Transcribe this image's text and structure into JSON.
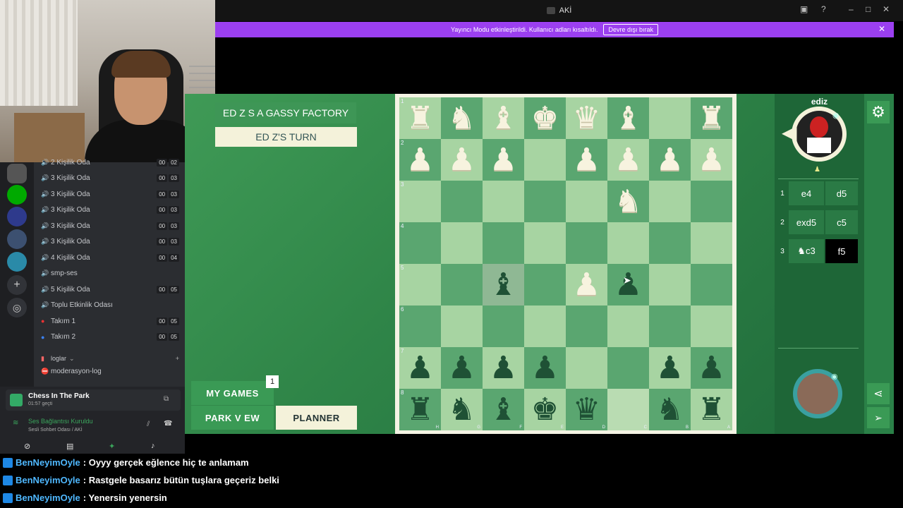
{
  "window": {
    "title": "AKİ"
  },
  "banner": {
    "message": "Yayıncı Modu etkinleştirildi. Kullanıcı adları kısaltıldı.",
    "button": "Devre dışı bırak"
  },
  "channels": [
    {
      "name": "2 Kişilik Oda",
      "a": "00",
      "b": "02"
    },
    {
      "name": "3 Kişilik Oda",
      "a": "00",
      "b": "03"
    },
    {
      "name": "3 Kişilik Oda",
      "a": "00",
      "b": "03"
    },
    {
      "name": "3 Kişilik Oda",
      "a": "00",
      "b": "03"
    },
    {
      "name": "3 Kişilik Oda",
      "a": "00",
      "b": "03"
    },
    {
      "name": "3 Kişilik Oda",
      "a": "00",
      "b": "03"
    },
    {
      "name": "4 Kişilik Oda",
      "a": "00",
      "b": "04"
    },
    {
      "name": "smp-ses",
      "a": "",
      "b": ""
    },
    {
      "name": "5 Kişilik Oda",
      "a": "00",
      "b": "05"
    },
    {
      "name": "Toplu Etkinlik Odası",
      "a": "",
      "b": ""
    },
    {
      "name": "Takım 1",
      "a": "00",
      "b": "05"
    },
    {
      "name": "Takım 2",
      "a": "00",
      "b": "05"
    }
  ],
  "category": {
    "name": "loglar"
  },
  "text_channel": {
    "name": "moderasyon-log"
  },
  "activity": {
    "name": "Chess In The Park",
    "time": "01:57 geçti"
  },
  "voice": {
    "status": "Ses Bağlantısı Kuruldu",
    "channel": "Sesli Sohbet Odası / AKİ"
  },
  "game": {
    "banner_title": "ED Z  S A GASSY FACTORY",
    "turn": "ED Z'S TURN",
    "buttons": {
      "my_games": "MY GAMES",
      "my_games_badge": "1",
      "park_view": "PARK V EW",
      "planner": "PLANNER"
    },
    "opponent": "ediz",
    "moves": [
      {
        "n": "1",
        "w": "e4",
        "b": "d5"
      },
      {
        "n": "2",
        "w": "exd5",
        "b": "c5"
      },
      {
        "n": "3",
        "w": "♞c3",
        "b": "f5"
      }
    ],
    "board": [
      [
        "♜",
        "♞",
        "♝",
        "♚",
        "♛",
        "♝",
        "",
        "♜"
      ],
      [
        "♟",
        "♟",
        "♟",
        "",
        "♟",
        "♟",
        "♟",
        "♟"
      ],
      [
        "",
        "",
        "",
        "",
        "",
        "♞",
        "",
        ""
      ],
      [
        "",
        "",
        "",
        "",
        "",
        "",
        "",
        ""
      ],
      [
        "",
        "",
        "♝",
        "",
        "♟",
        "♟",
        "",
        ""
      ],
      [
        "",
        "",
        "",
        "",
        "",
        "",
        "",
        ""
      ],
      [
        "♟",
        "♟",
        "♟",
        "♟",
        "",
        "",
        "♟",
        "♟"
      ],
      [
        "♜",
        "♞",
        "♝",
        "♚",
        "♛",
        "",
        "♞",
        "♜"
      ]
    ],
    "colors": [
      [
        "w",
        "w",
        "w",
        "w",
        "w",
        "w",
        "",
        "w"
      ],
      [
        "w",
        "w",
        "w",
        "",
        "w",
        "w",
        "w",
        "w"
      ],
      [
        "",
        "",
        "",
        "",
        "",
        "w",
        "",
        ""
      ],
      [
        "",
        "",
        "",
        "",
        "",
        "",
        "",
        ""
      ],
      [
        "",
        "",
        "b",
        "",
        "w",
        "b",
        "",
        ""
      ],
      [
        "",
        "",
        "",
        "",
        "",
        "",
        "",
        ""
      ],
      [
        "b",
        "b",
        "b",
        "b",
        "",
        "",
        "b",
        "b"
      ],
      [
        "b",
        "b",
        "b",
        "b",
        "b",
        "",
        "b",
        "b"
      ]
    ],
    "ranks": [
      "1",
      "2",
      "3",
      "4",
      "5",
      "6",
      "7",
      "8"
    ],
    "files": [
      "H",
      "G",
      "F",
      "E",
      "D",
      "C",
      "B",
      "A"
    ]
  },
  "chat": [
    {
      "user": "BenNeyimOyle",
      "text": ": Oyyy gerçek eğlence hiç te anlamam"
    },
    {
      "user": "BenNeyimOyle",
      "text": ": Rastgele basarız bütün tuşlara geçeriz belki"
    },
    {
      "user": "BenNeyimOyle",
      "text": ": Yenersin yenersin"
    }
  ],
  "colors": {
    "accent": "#9b3ff0",
    "board_light": "#a7d4a2",
    "board_dark": "#5aa670"
  }
}
